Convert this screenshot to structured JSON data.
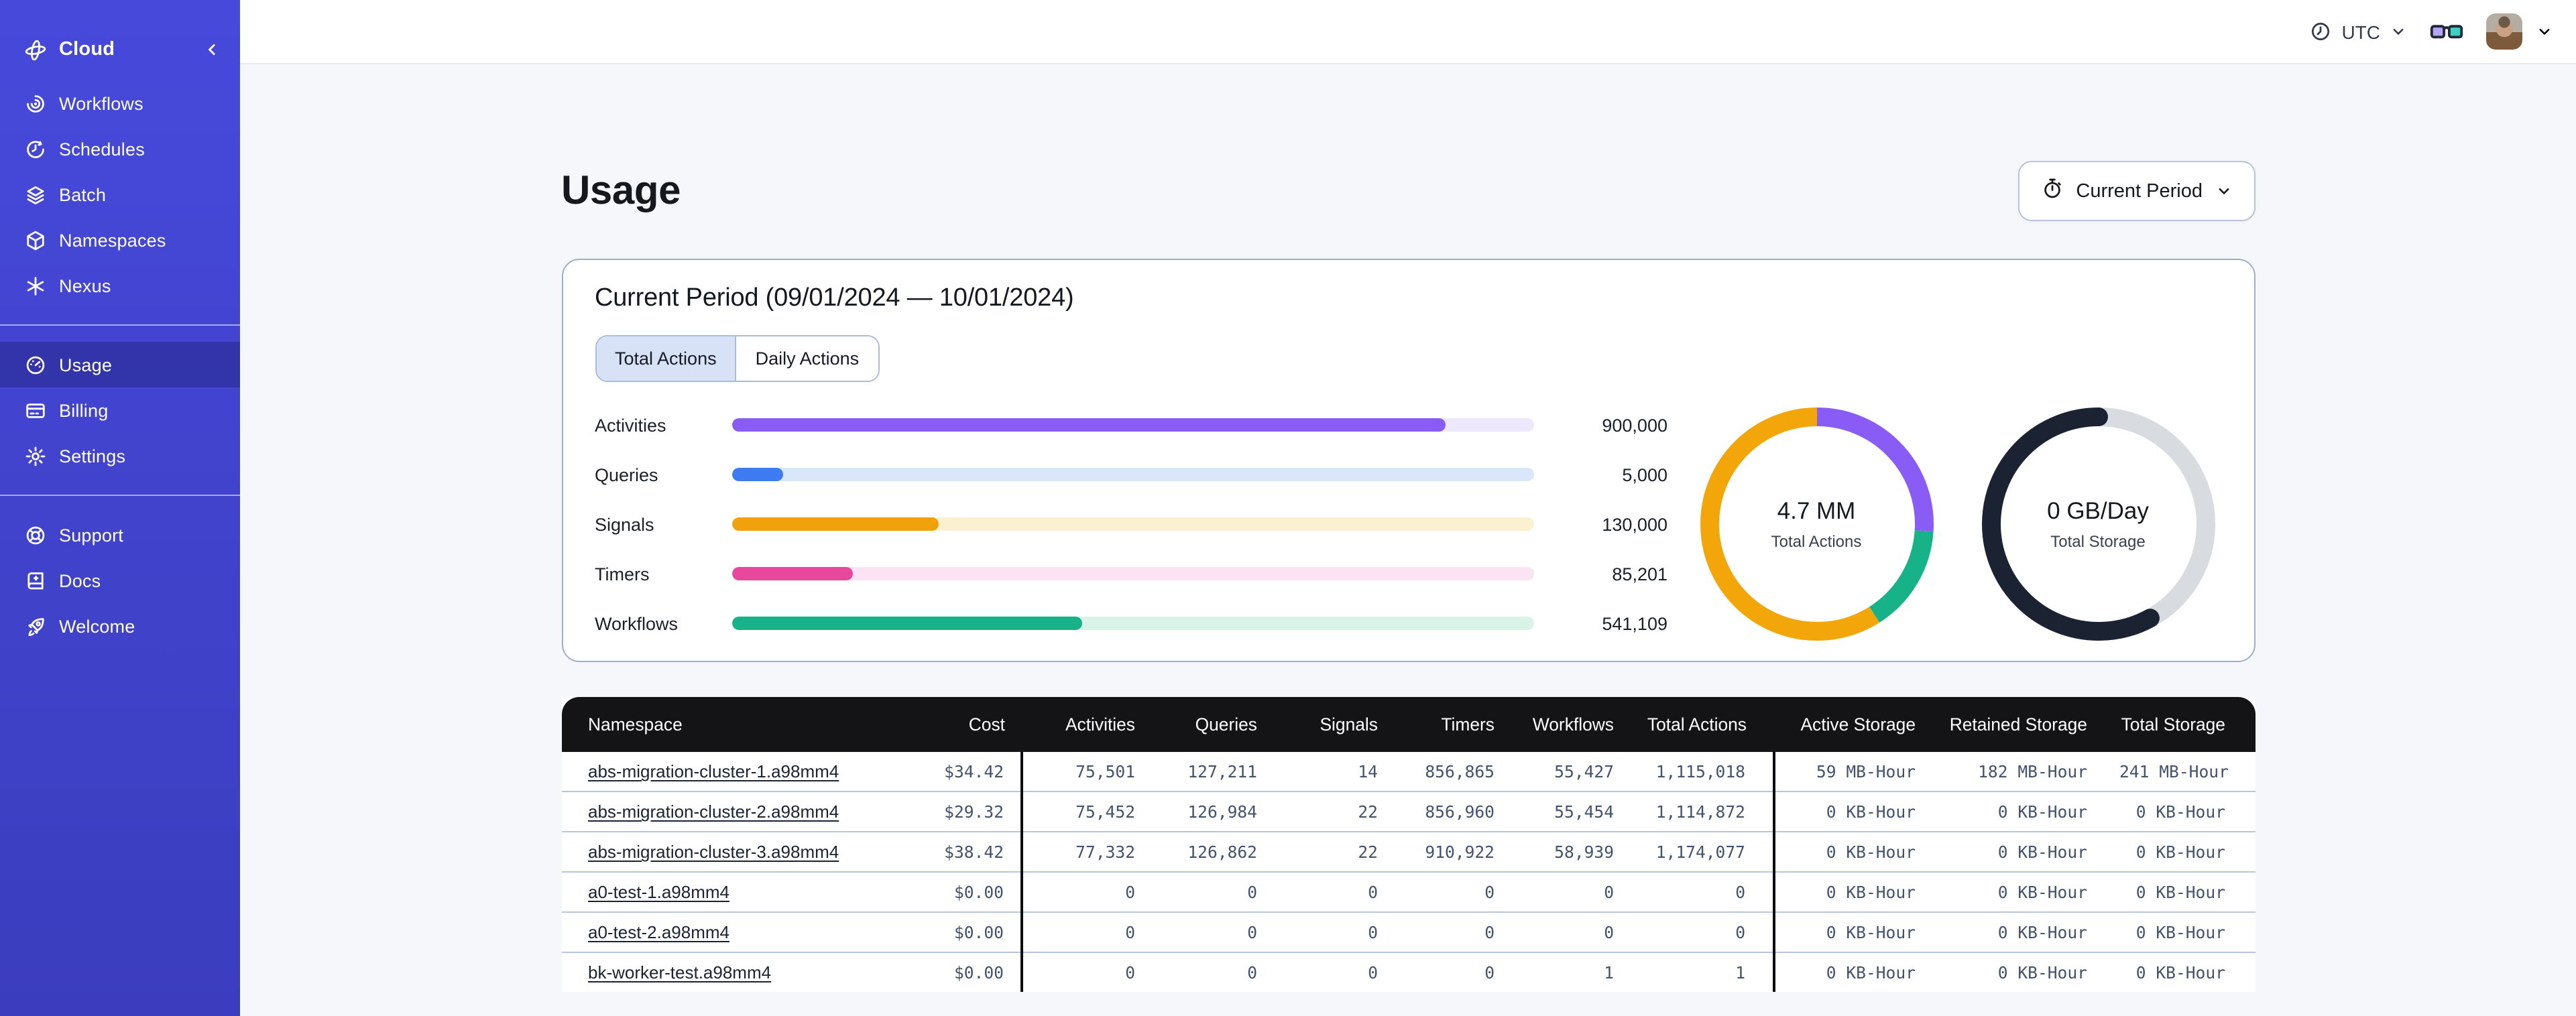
{
  "colors": {
    "sidebar_top": "#4749DB",
    "sidebar_bottom": "#3B3DBE",
    "page_background": "#F6F7FA",
    "card_border": "#9FAEC9",
    "table_header_background": "#141416",
    "row_separator": "#B6C5E2",
    "selected_tab_background": "#D7E2F6"
  },
  "sidebar": {
    "groups": [
      {
        "items": [
          {
            "label": "Cloud",
            "icon": "cloud-logo",
            "header": true
          },
          {
            "label": "Workflows",
            "icon": "workflows"
          },
          {
            "label": "Schedules",
            "icon": "schedules"
          },
          {
            "label": "Batch",
            "icon": "batch"
          },
          {
            "label": "Namespaces",
            "icon": "namespaces"
          },
          {
            "label": "Nexus",
            "icon": "nexus"
          }
        ]
      },
      {
        "items": [
          {
            "label": "Usage",
            "icon": "usage",
            "active": true
          },
          {
            "label": "Billing",
            "icon": "billing"
          },
          {
            "label": "Settings",
            "icon": "settings"
          }
        ]
      },
      {
        "items": [
          {
            "label": "Support",
            "icon": "support"
          },
          {
            "label": "Docs",
            "icon": "docs"
          },
          {
            "label": "Welcome",
            "icon": "welcome"
          }
        ]
      }
    ]
  },
  "topbar": {
    "timezone": {
      "label": "UTC",
      "icon": "clock"
    }
  },
  "page": {
    "title": "Usage",
    "period_button": {
      "label": "Current Period",
      "icon": "stopwatch"
    }
  },
  "card": {
    "title": "Current Period (09/01/2024 — 10/01/2024)",
    "tabs": [
      {
        "label": "Total Actions",
        "active": true
      },
      {
        "label": "Daily Actions",
        "active": false
      }
    ],
    "bars": [
      {
        "label": "Activities",
        "value": "900,000",
        "percent": 89,
        "color": "#8A5CF6",
        "track": "#EDE8FC"
      },
      {
        "label": "Queries",
        "value": "5,000",
        "percent": 6.5,
        "color": "#3E7BF0",
        "track": "#DAE6F9"
      },
      {
        "label": "Signals",
        "value": "130,000",
        "percent": 25.8,
        "color": "#F0A10B",
        "track": "#FBF0CF"
      },
      {
        "label": "Timers",
        "value": "85,201",
        "percent": 15.2,
        "color": "#E8489B",
        "track": "#FBE3F3"
      },
      {
        "label": "Workflows",
        "value": "541,109",
        "percent": 43.8,
        "color": "#17B287",
        "track": "#D9F3E7"
      }
    ],
    "donuts": [
      {
        "value": "4.7 MM",
        "label": "Total Actions",
        "rounded_cap": false,
        "segments": [
          {
            "name": "activities",
            "color": "#8A5CF6",
            "fraction": 0.26
          },
          {
            "name": "workflows",
            "color": "#17B287",
            "fraction": 0.15
          },
          {
            "name": "signals",
            "color": "#F2A60A",
            "fraction": 0.59
          }
        ]
      },
      {
        "value": "0 GB/Day",
        "label": "Total Storage",
        "rounded_cap": true,
        "segments": [
          {
            "name": "free",
            "color": "#D8DBE0",
            "fraction": 0.42
          },
          {
            "name": "used",
            "color": "#1B2232",
            "fraction": 0.58
          }
        ]
      }
    ]
  },
  "table": {
    "columns": [
      "Namespace",
      "Cost",
      "Activities",
      "Queries",
      "Signals",
      "Timers",
      "Workflows",
      "Total Actions",
      "Active Storage",
      "Retained Storage",
      "Total Storage"
    ],
    "rows": [
      [
        "abs-migration-cluster-1.a98mm4",
        "$34.42",
        "75,501",
        "127,211",
        "14",
        "856,865",
        "55,427",
        "1,115,018",
        "59 MB-Hour",
        "182 MB-Hour",
        "241 MB-Hour"
      ],
      [
        "abs-migration-cluster-2.a98mm4",
        "$29.32",
        "75,452",
        "126,984",
        "22",
        "856,960",
        "55,454",
        "1,114,872",
        "0 KB-Hour",
        "0 KB-Hour",
        "0 KB-Hour"
      ],
      [
        "abs-migration-cluster-3.a98mm4",
        "$38.42",
        "77,332",
        "126,862",
        "22",
        "910,922",
        "58,939",
        "1,174,077",
        "0 KB-Hour",
        "0 KB-Hour",
        "0 KB-Hour"
      ],
      [
        "a0-test-1.a98mm4",
        "$0.00",
        "0",
        "0",
        "0",
        "0",
        "0",
        "0",
        "0 KB-Hour",
        "0 KB-Hour",
        "0 KB-Hour"
      ],
      [
        "a0-test-2.a98mm4",
        "$0.00",
        "0",
        "0",
        "0",
        "0",
        "0",
        "0",
        "0 KB-Hour",
        "0 KB-Hour",
        "0 KB-Hour"
      ],
      [
        "bk-worker-test.a98mm4",
        "$0.00",
        "0",
        "0",
        "0",
        "0",
        "1",
        "1",
        "0 KB-Hour",
        "0 KB-Hour",
        "0 KB-Hour"
      ]
    ]
  }
}
